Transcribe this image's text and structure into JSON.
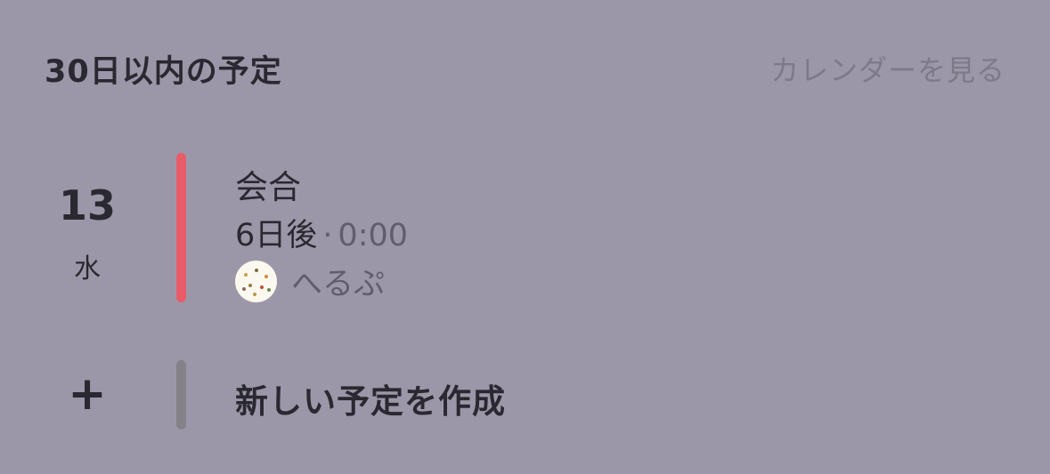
{
  "header": {
    "title": "30日以内の予定",
    "calendar_link": "カレンダーを見る"
  },
  "events": [
    {
      "day": "13",
      "weekday": "水",
      "title": "会合",
      "relative": "6日後",
      "separator": "·",
      "time": "0:00",
      "owner": "へるぷ",
      "bar_color": "#e85c6a",
      "avatar_icon": "avatar-image"
    }
  ],
  "create": {
    "icon": "+",
    "label": "新しい予定を作成"
  },
  "colors": {
    "background": "#9c97a8",
    "text": "#2a2830",
    "muted": "#615c6e",
    "link": "#7e7989",
    "event_bar": "#e85c6a",
    "create_bar": "#848189"
  }
}
